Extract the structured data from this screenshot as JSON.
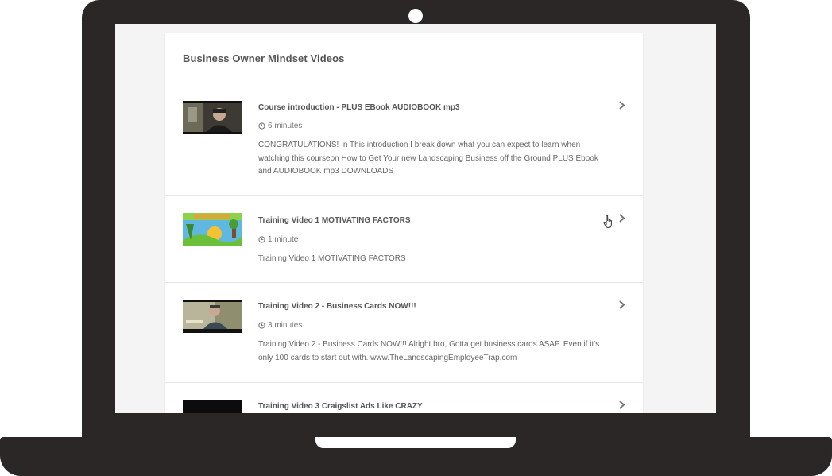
{
  "panel": {
    "title": "Business Owner Mindset Videos"
  },
  "lessons": [
    {
      "title": "Course introduction - PLUS EBook AUDIOBOOK mp3",
      "duration": "6 minutes",
      "description": "CONGRATULATIONS! In This introduction I break down what you can expect to learn when watching this courseon How to Get Your new Landscaping Business off the Ground PLUS Ebook and AUDIOBOOK mp3 DOWNLOADS",
      "thumbnail_icon": "video-thumbnail-icon"
    },
    {
      "title": "Training Video 1 MOTIVATING FACTORS",
      "duration": "1 minute",
      "description": "Training Video 1 MOTIVATING FACTORS",
      "thumbnail_icon": "video-thumbnail-icon"
    },
    {
      "title": "Training Video 2 - Business Cards NOW!!!",
      "duration": "3 minutes",
      "description": "Training Video 2 - Business Cards NOW!!! Alright bro, Gotta get business cards ASAP. Even if it's only 100 cards to start out with. www.TheLandscapingEmployeeTrap.com",
      "thumbnail_icon": "video-thumbnail-icon"
    },
    {
      "title": "Training Video 3 Craigslist Ads Like CRAZY",
      "duration": "",
      "description": "",
      "thumbnail_icon": "video-thumbnail-icon"
    }
  ],
  "icons": {
    "duration": "clock-icon",
    "open": "chevron-right-icon",
    "pointer": "hand-cursor-icon"
  },
  "colors": {
    "laptop_frame": "#2b2727",
    "screen_background": "#f4f4f4",
    "panel_background": "#ffffff",
    "divider": "#e6e6e6",
    "text_primary": "#555555",
    "text_secondary": "#666666"
  }
}
